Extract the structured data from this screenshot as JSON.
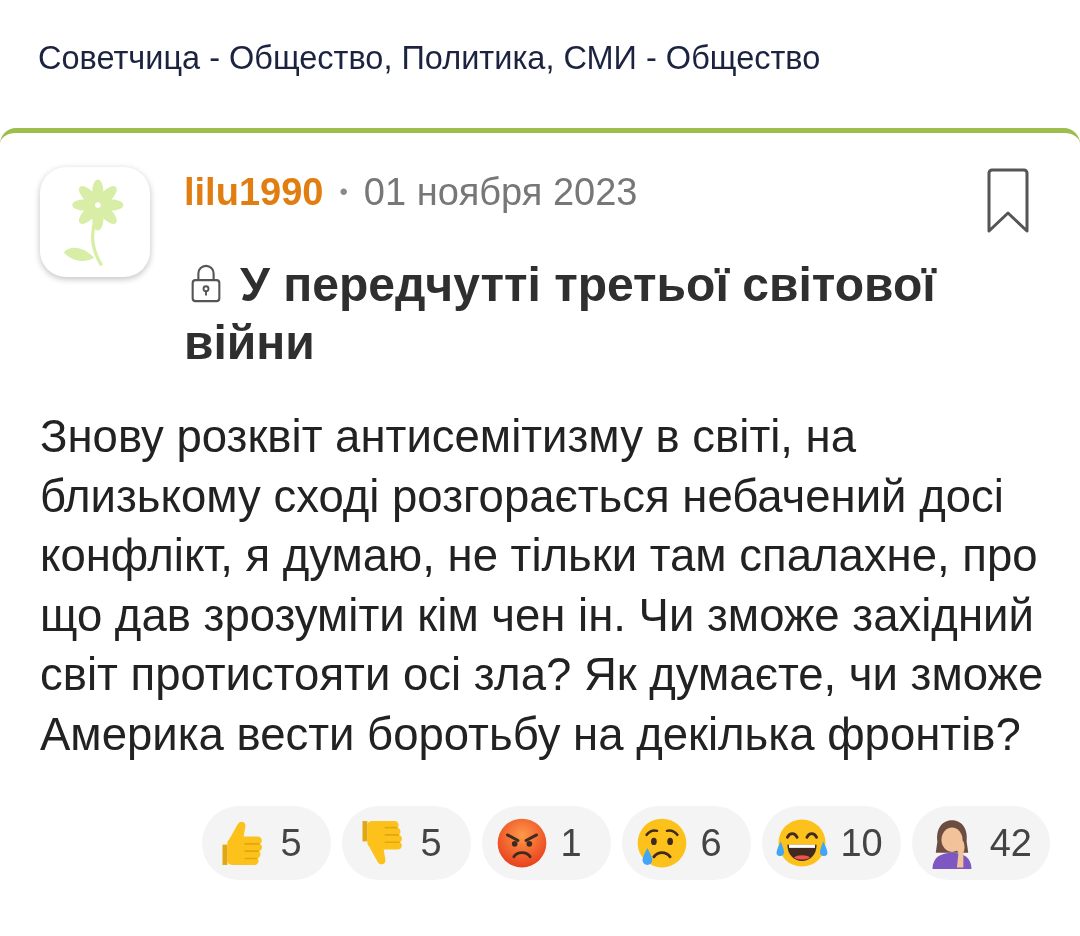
{
  "breadcrumb": "Советчица - Общество, Политика, СМИ - Общество",
  "post": {
    "author": "lilu1990",
    "separator": "•",
    "date": "01 ноября 2023",
    "bookmarked": false,
    "locked": true,
    "title": "У передчутті третьої світової війни",
    "body": "Знову розквіт антисемітизму в світі, на близькому сході розгорається небачений досі конфлікт, я думаю, не тільки там спалахне, про що дав зрозуміти кім чен ін. Чи зможе західний світ протистояти осі зла? Як думаєте, чи зможе Америка вести боротьбу на декілька фронтів?"
  },
  "reactions": [
    {
      "kind": "like",
      "count": "5"
    },
    {
      "kind": "dislike",
      "count": "5"
    },
    {
      "kind": "angry",
      "count": "1"
    },
    {
      "kind": "sad",
      "count": "6"
    },
    {
      "kind": "laugh",
      "count": "10"
    },
    {
      "kind": "facepalm",
      "count": "42"
    }
  ]
}
